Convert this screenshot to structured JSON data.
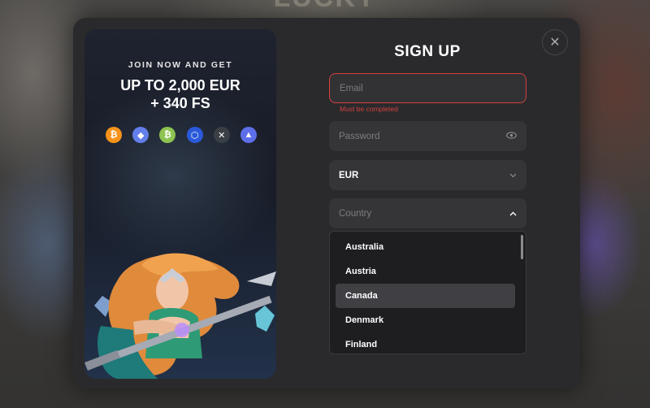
{
  "background": {
    "title": "LUCKY"
  },
  "promo": {
    "kicker": "JOIN NOW AND GET",
    "headline_line1": "UP TO 2,000 EUR",
    "headline_line2": "+ 340 FS",
    "crypto_icons": [
      {
        "name": "bitcoin-icon",
        "glyph": "₿",
        "color": "#f7931a"
      },
      {
        "name": "ethereum-icon",
        "glyph": "◆",
        "color": "#627eea"
      },
      {
        "name": "bitcoin-cash-icon",
        "glyph": "₿",
        "color": "#8dc351"
      },
      {
        "name": "chainlink-icon",
        "glyph": "⬡",
        "color": "#2a5ada"
      },
      {
        "name": "xrp-icon",
        "glyph": "✕",
        "color": "#3a3f46"
      },
      {
        "name": "tron-icon",
        "glyph": "▲",
        "color": "#5d6fe8"
      }
    ]
  },
  "modal": {
    "close_glyph": "✕",
    "title": "SIGN UP"
  },
  "form": {
    "email": {
      "placeholder": "Email",
      "error": "Must be completed"
    },
    "password": {
      "placeholder": "Password",
      "icon": "eye-icon"
    },
    "currency": {
      "value": "EUR",
      "icon": "chevron-down-icon"
    },
    "country": {
      "placeholder": "Country",
      "icon": "chevron-up-icon"
    },
    "country_options": [
      "Australia",
      "Austria",
      "Canada",
      "Denmark",
      "Finland"
    ],
    "highlighted_option": "Canada"
  },
  "colors": {
    "error": "#d3403d",
    "modal_bg": "#2a2a2d",
    "field_bg": "#353538",
    "dropdown_highlight": "#3f3f44"
  }
}
